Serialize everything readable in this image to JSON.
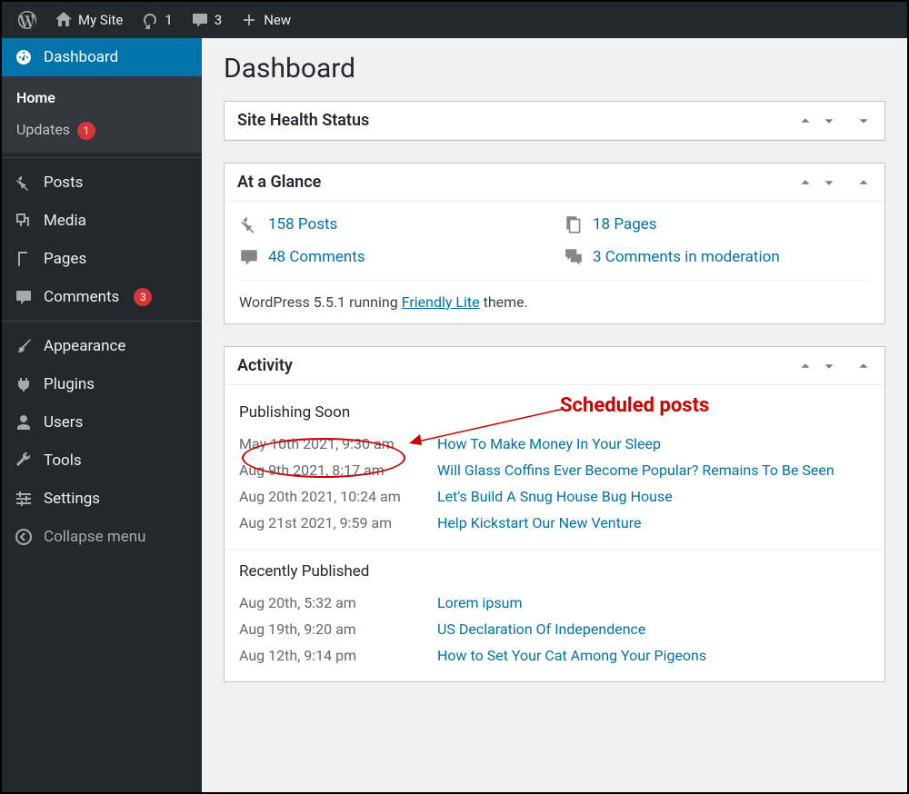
{
  "adminbar": {
    "site_name": "My Site",
    "updates_count": "1",
    "comments_count": "3",
    "new_label": "New"
  },
  "sidebar": {
    "dashboard": "Dashboard",
    "home": "Home",
    "updates": "Updates",
    "updates_badge": "1",
    "posts": "Posts",
    "media": "Media",
    "pages": "Pages",
    "comments": "Comments",
    "comments_badge": "3",
    "appearance": "Appearance",
    "plugins": "Plugins",
    "users": "Users",
    "tools": "Tools",
    "settings": "Settings",
    "collapse": "Collapse menu"
  },
  "page": {
    "title": "Dashboard"
  },
  "site_health": {
    "title": "Site Health Status"
  },
  "glance": {
    "title": "At a Glance",
    "posts": "158 Posts",
    "pages": "18 Pages",
    "comments": "48 Comments",
    "moderation": "3 Comments in moderation",
    "version_pre": "WordPress 5.5.1 running ",
    "theme": "Friendly Lite",
    "version_post": " theme."
  },
  "activity": {
    "title": "Activity",
    "soon_title": "Publishing Soon",
    "soon": [
      {
        "date": "May 10th 2021, 9:30 am",
        "title": "How To Make Money In Your Sleep"
      },
      {
        "date": "Aug 9th 2021, 8:17 am",
        "title": "Will Glass Coffins Ever Become Popular? Remains To Be Seen"
      },
      {
        "date": "Aug 20th 2021, 10:24 am",
        "title": "Let's Build A Snug House Bug House"
      },
      {
        "date": "Aug 21st 2021, 9:59 am",
        "title": "Help Kickstart Our New Venture"
      }
    ],
    "recent_title": "Recently Published",
    "recent": [
      {
        "date": "Aug 20th, 5:32 am",
        "title": "Lorem ipsum"
      },
      {
        "date": "Aug 19th, 9:20 am",
        "title": "US Declaration Of Independence"
      },
      {
        "date": "Aug 12th, 9:14 pm",
        "title": "How to Set Your Cat Among Your Pigeons"
      }
    ]
  },
  "annotation": {
    "label": "Scheduled posts"
  }
}
